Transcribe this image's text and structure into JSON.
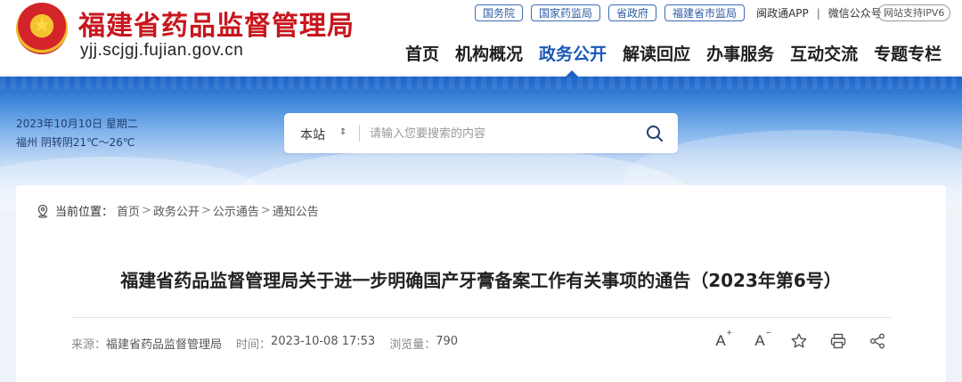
{
  "header": {
    "site_name": "福建省药品监督管理局",
    "site_domain": "yjj.scjgj.fujian.gov.cn",
    "top_links": [
      "国务院",
      "国家药监局",
      "省政府",
      "福建省市监局"
    ],
    "app_link": "闽政通APP",
    "wechat_link": "微信公众号",
    "ipv6_badge": "网站支持IPV6",
    "nav": [
      "首页",
      "机构概况",
      "政务公开",
      "解读回应",
      "办事服务",
      "互动交流",
      "专题专栏"
    ],
    "nav_active": "政务公开"
  },
  "banner": {
    "date": "2023年10月10日 星期二",
    "weather": "福州 阴转阴21℃～26℃"
  },
  "search": {
    "scope": "本站",
    "placeholder": "请输入您要搜索的内容"
  },
  "breadcrumb": {
    "label": "当前位置：",
    "items": [
      "首页",
      "政务公开",
      "公示通告",
      "通知公告"
    ],
    "separator": ">"
  },
  "article": {
    "title": "福建省药品监督管理局关于进一步明确国产牙膏备案工作有关事项的通告（2023年第6号）",
    "source_label": "来源：",
    "source": "福建省药品监督管理局",
    "time_label": "时间：",
    "time": "2023-10-08 17:53",
    "views_label": "浏览量：",
    "views": "790"
  },
  "tools": {
    "font_increase": "A",
    "font_decrease": "A"
  },
  "colors": {
    "brand_red": "#c8161d",
    "nav_active": "#1a57b8",
    "banner_top": "#1c63c7"
  }
}
